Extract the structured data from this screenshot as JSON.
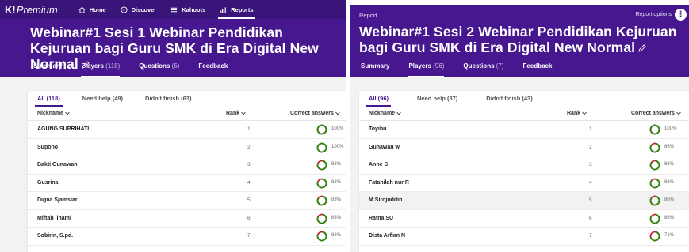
{
  "left": {
    "nav": {
      "logo_brand": "K!",
      "logo_product": "Premium",
      "items": [
        {
          "label": "Home",
          "icon": "home-icon"
        },
        {
          "label": "Discover",
          "icon": "compass-icon"
        },
        {
          "label": "Kahoots",
          "icon": "list-icon"
        },
        {
          "label": "Reports",
          "icon": "bar-chart-icon",
          "active": true
        }
      ]
    },
    "title": "Webinar#1 Sesi 1 Webinar Pendidikan Kejuruan bagi Guru SMK di Era Digital New Normal",
    "tabs": [
      {
        "label": "Summary",
        "count": ""
      },
      {
        "label": "Players",
        "count": "(118)",
        "active": true
      },
      {
        "label": "Questions",
        "count": "(6)"
      },
      {
        "label": "Feedback",
        "count": ""
      }
    ],
    "filters": [
      {
        "label": "All (118)",
        "active": true
      },
      {
        "label": "Need help (49)"
      },
      {
        "label": "Didn't finish (63)"
      }
    ],
    "columns": {
      "nickname": "Nickname",
      "rank": "Rank",
      "correct": "Correct answers"
    },
    "rows": [
      {
        "name": "AGUNG SUPRIHATI",
        "rank": "1",
        "pct": "100%",
        "fraction": 1.0
      },
      {
        "name": "Supono",
        "rank": "2",
        "pct": "100%",
        "fraction": 1.0
      },
      {
        "name": "Bakti Gunawan",
        "rank": "3",
        "pct": "83%",
        "fraction": 0.83
      },
      {
        "name": "Gusrina",
        "rank": "4",
        "pct": "83%",
        "fraction": 0.83
      },
      {
        "name": "Digna Sjamsiar",
        "rank": "5",
        "pct": "83%",
        "fraction": 0.83
      },
      {
        "name": "Miftah Ilhami",
        "rank": "6",
        "pct": "83%",
        "fraction": 0.83
      },
      {
        "name": "Sobirin, S.pd.",
        "rank": "7",
        "pct": "83%",
        "fraction": 0.83
      }
    ]
  },
  "right": {
    "report_label": "Report",
    "report_options_label": "Report options",
    "title": "Webinar#1 Sesi 2 Webinar Pendidikan Kejuruan bagi Guru SMK di Era Digital New Normal",
    "tabs": [
      {
        "label": "Summary",
        "count": ""
      },
      {
        "label": "Players",
        "count": "(96)",
        "active": true
      },
      {
        "label": "Questions",
        "count": "(7)"
      },
      {
        "label": "Feedback",
        "count": ""
      }
    ],
    "filters": [
      {
        "label": "All (96)",
        "active": true
      },
      {
        "label": "Need help (37)"
      },
      {
        "label": "Didn't finish (43)"
      }
    ],
    "columns": {
      "nickname": "Nickname",
      "rank": "Rank",
      "correct": "Correct answers"
    },
    "rows": [
      {
        "name": "Toyibu",
        "rank": "1",
        "pct": "100%",
        "fraction": 1.0
      },
      {
        "name": "Gunawan w",
        "rank": "2",
        "pct": "86%",
        "fraction": 0.86
      },
      {
        "name": "Anne S",
        "rank": "3",
        "pct": "86%",
        "fraction": 0.86
      },
      {
        "name": "Fatahilah nur R",
        "rank": "4",
        "pct": "86%",
        "fraction": 0.86
      },
      {
        "name": "M.Sirojuddin",
        "rank": "5",
        "pct": "86%",
        "fraction": 0.86,
        "highlight": true
      },
      {
        "name": "Ratna SU",
        "rank": "6",
        "pct": "86%",
        "fraction": 0.86
      },
      {
        "name": "Dista Arfian N",
        "rank": "7",
        "pct": "71%",
        "fraction": 0.71
      }
    ]
  },
  "colors": {
    "purple": "#46178f",
    "correct": "#26890c",
    "incorrect": "#e21b3c"
  }
}
